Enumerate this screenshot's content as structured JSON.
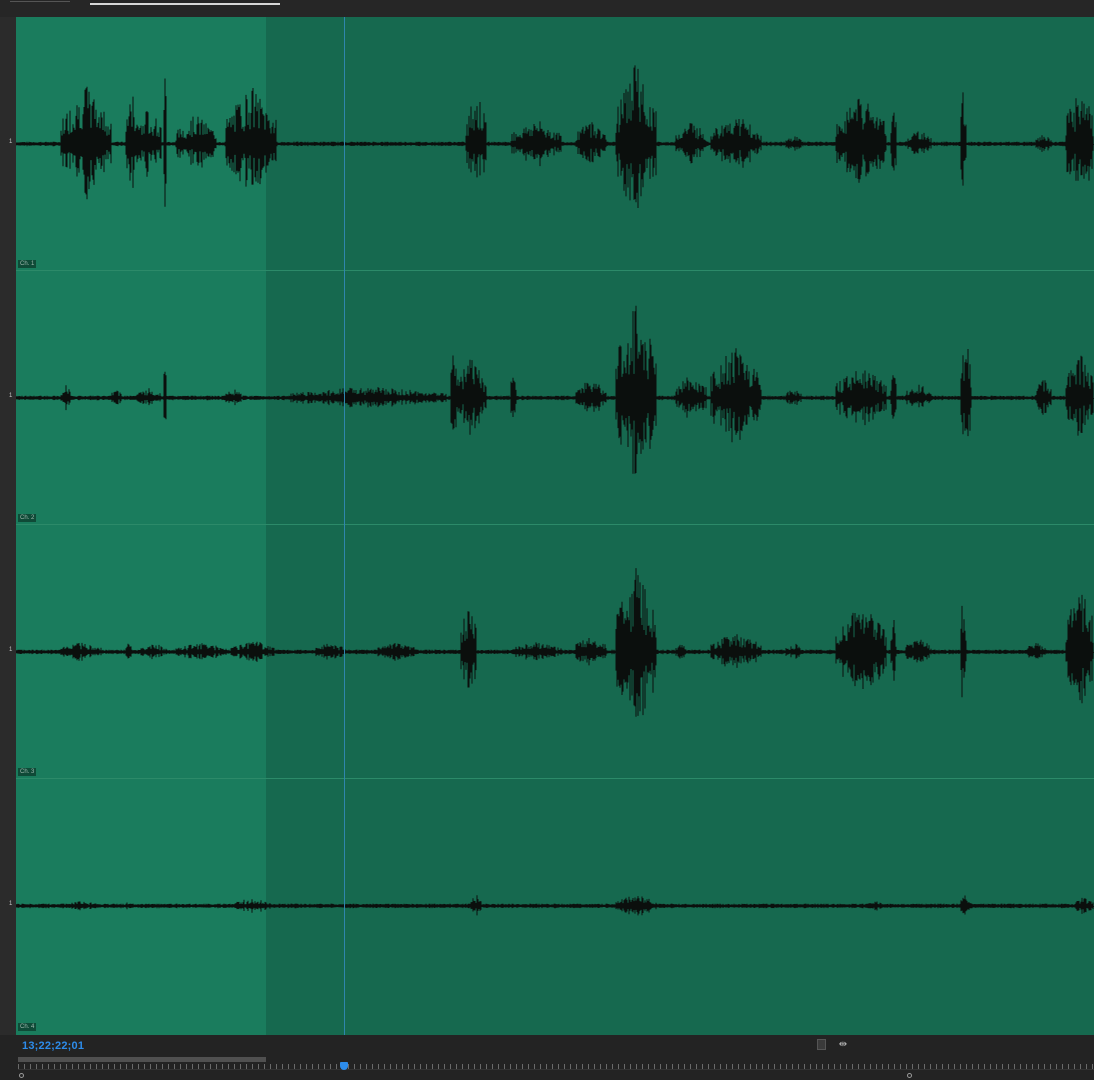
{
  "editor": {
    "timecode": "13;22;22;01",
    "channels": [
      {
        "label": "Ch. 1",
        "scale_mark": "1"
      },
      {
        "label": "Ch. 2",
        "scale_mark": "1"
      },
      {
        "label": "Ch. 3",
        "scale_mark": "1"
      },
      {
        "label": "Ch. 4",
        "scale_mark": "1"
      }
    ]
  },
  "toolbar": {
    "waveform_view_icon": "waveform-view-icon",
    "fit_icon": "fit-to-window-icon"
  },
  "colors": {
    "waveform_bg": "#16694f",
    "selection": "#1a7c5d",
    "waveform": "#0b0f0d",
    "playhead": "#2f86ad",
    "timecode": "#2d8ceb"
  }
}
